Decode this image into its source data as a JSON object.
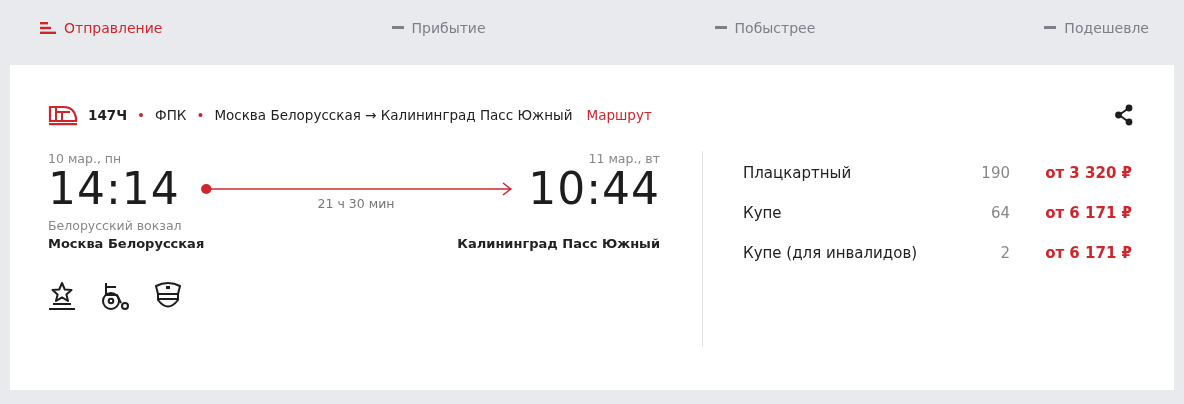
{
  "sort_tabs": [
    {
      "label": "Отправление",
      "selected": true
    },
    {
      "label": "Прибытие",
      "selected": false
    },
    {
      "label": "Побыстрее",
      "selected": false
    },
    {
      "label": "Подешевле",
      "selected": false
    }
  ],
  "train": {
    "number": "147Ч",
    "separator": "•",
    "carrier": "ФПК",
    "route": "Москва Белорусская → Калининград Пасс Южный",
    "route_link": "Маршрут"
  },
  "departure": {
    "date": "10 мар., пн",
    "time": "14:14",
    "station_note": "Белорусский вокзал",
    "station": "Москва Белорусская"
  },
  "duration": "21 ч 30 мин",
  "arrival": {
    "date": "11 мар., вт",
    "time": "10:44",
    "station": "Калининград Пасс Южный"
  },
  "fares": [
    {
      "class": "Плацкартный",
      "seats": "190",
      "price": "от 3 320 ₽"
    },
    {
      "class": "Купе",
      "seats": "64",
      "price": "от 6 171 ₽"
    },
    {
      "class": "Купе (для инвалидов)",
      "seats": "2",
      "price": "от 6 171 ₽"
    }
  ]
}
